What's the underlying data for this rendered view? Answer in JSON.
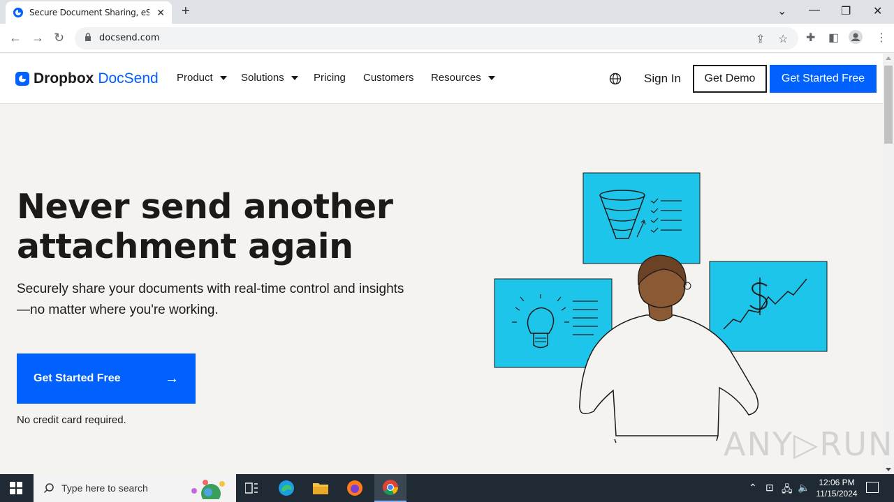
{
  "browser": {
    "tab_title": "Secure Document Sharing, eSign",
    "tab_close": "✕",
    "new_tab": "+",
    "url": "docsend.com"
  },
  "nav": {
    "brand_primary": "Dropbox",
    "brand_secondary": "DocSend",
    "items": [
      {
        "label": "Product",
        "dropdown": true
      },
      {
        "label": "Solutions",
        "dropdown": true
      },
      {
        "label": "Pricing",
        "dropdown": false
      },
      {
        "label": "Customers",
        "dropdown": false
      },
      {
        "label": "Resources",
        "dropdown": true
      }
    ],
    "sign_in": "Sign In",
    "get_demo": "Get Demo",
    "get_started": "Get Started Free"
  },
  "hero": {
    "title_line1": "Never send another",
    "title_line2": "attachment again",
    "subtitle": "Securely share your documents with real-time control and insights—no matter where you're working.",
    "cta": "Get Started Free",
    "cta_arrow": "→",
    "note": "No credit card required."
  },
  "watermark": "ANY▷RUN",
  "taskbar": {
    "search_placeholder": "Type here to search",
    "time": "12:06 PM",
    "date": "11/15/2024"
  },
  "colors": {
    "brand_blue": "#0061fe",
    "hero_bg": "#f4f3f0",
    "illustration_cyan": "#1ec5ea"
  }
}
